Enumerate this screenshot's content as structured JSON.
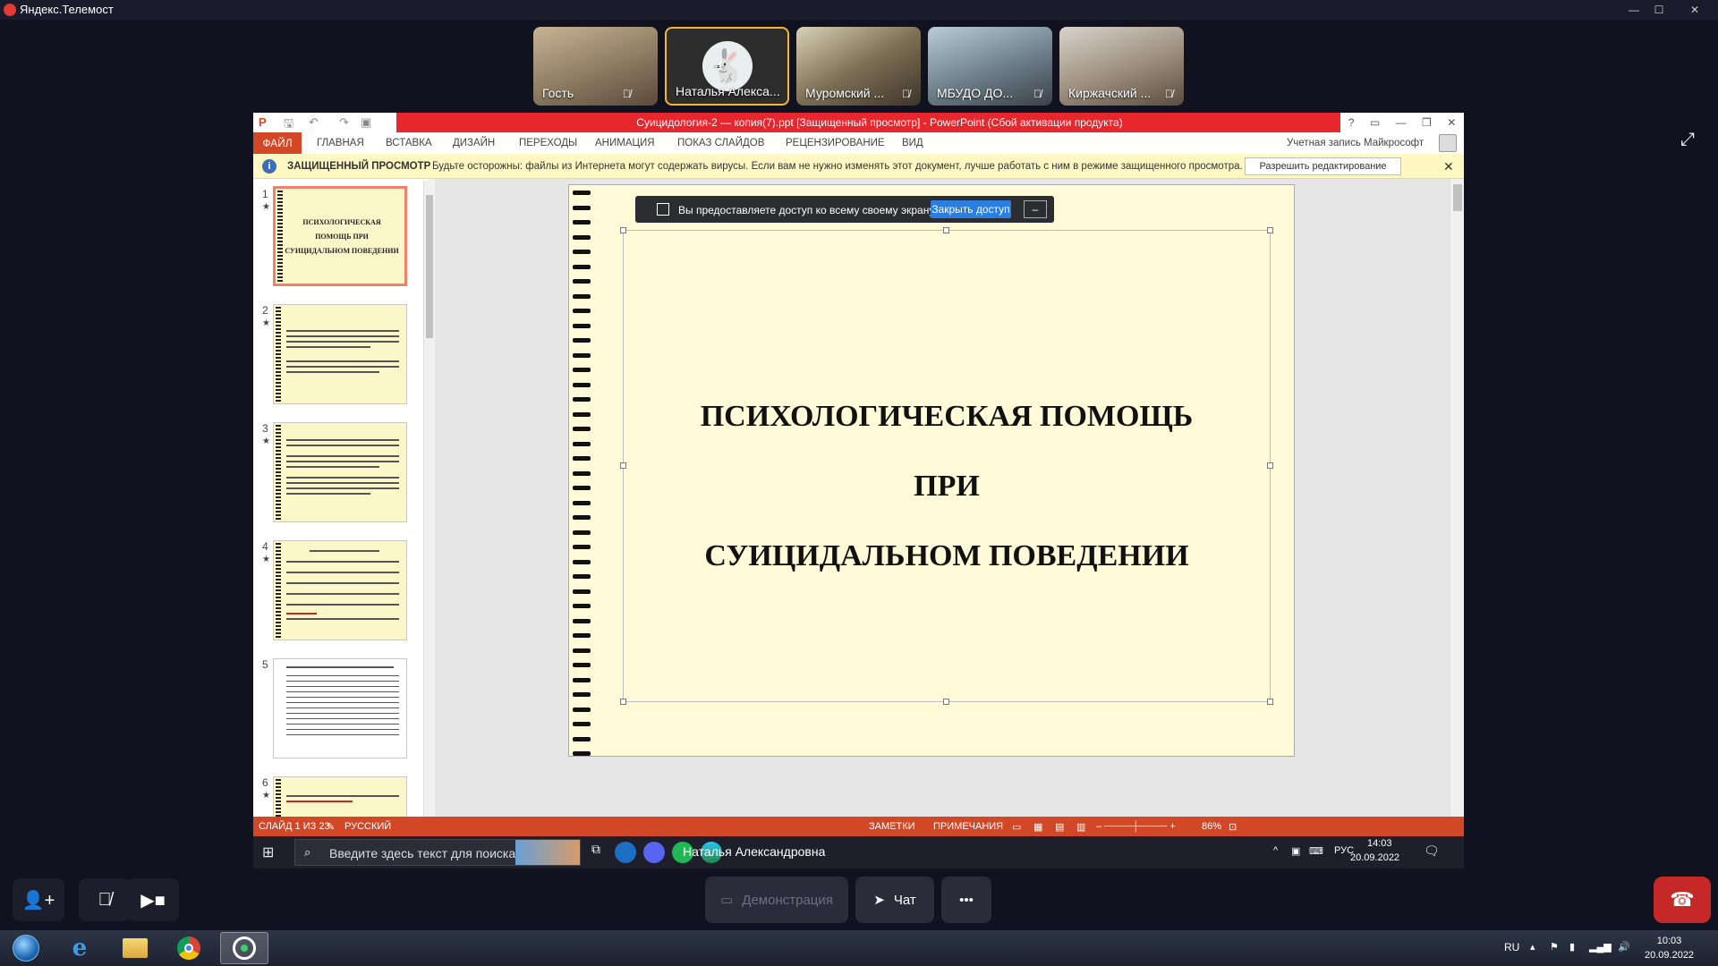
{
  "window": {
    "title": "Яндекс.Телемост"
  },
  "participants": [
    {
      "name": "Гость",
      "muted": true
    },
    {
      "name": "Наталья Алекса...",
      "muted": false,
      "active": true
    },
    {
      "name": "Муромский ...",
      "muted": true
    },
    {
      "name": "МБУДО ДО...",
      "muted": true
    },
    {
      "name": "Киржачский ...",
      "muted": true
    }
  ],
  "ppt": {
    "doc_title": "Суицидология-2 — копия(7).ppt [Защищенный просмотр] - PowerPoint (Сбой активации продукта)",
    "ribbon_tabs": [
      "ФАЙЛ",
      "ГЛАВНАЯ",
      "ВСТАВКА",
      "ДИЗАЙН",
      "ПЕРЕХОДЫ",
      "АНИМАЦИЯ",
      "ПОКАЗ СЛАЙДОВ",
      "РЕЦЕНЗИРОВАНИЕ",
      "ВИД"
    ],
    "account": "Учетная запись Майкрософт",
    "protected": {
      "title": "ЗАЩИЩЕННЫЙ ПРОСМОТР",
      "message": "Будьте осторожны: файлы из Интернета могут содержать вирусы. Если вам не нужно изменять этот документ, лучше работать с ним в режиме защищенного просмотра.",
      "enable_button": "Разрешить редактирование"
    },
    "thumbnails": [
      {
        "num": "1",
        "text": "ПСИХОЛОГИЧЕСКАЯ ПОМОЩЬ ПРИ СУИЦИДАЛЬНОМ ПОВЕДЕНИИ"
      },
      {
        "num": "2",
        "text": ""
      },
      {
        "num": "3",
        "text": ""
      },
      {
        "num": "4",
        "text": ""
      },
      {
        "num": "5",
        "text": ""
      },
      {
        "num": "6",
        "text": ""
      }
    ],
    "slide": {
      "line1": "ПСИХОЛОГИЧЕСКАЯ ПОМОЩЬ",
      "line2": "ПРИ",
      "line3": "СУИЦИДАЛЬНОМ ПОВЕДЕНИИ"
    },
    "share_bar": {
      "text": "Вы предоставляете доступ ко всему своему экрану.",
      "stop": "Закрыть доступ",
      "minimize": "–"
    },
    "status": {
      "slide": "СЛАЙД 1 ИЗ 23",
      "lang": "РУССКИЙ",
      "notes": "ЗАМЕТКИ",
      "comments": "ПРИМЕЧАНИЯ",
      "zoom": "86%"
    },
    "inner_taskbar": {
      "search_placeholder": "Введите здесь текст для поиска",
      "presenter": "Наталья Александровна",
      "lang": "РУС",
      "time": "14:03",
      "date": "20.09.2022"
    }
  },
  "controls": {
    "demo": "Демонстрация",
    "chat": "Чат",
    "more": "•••"
  },
  "taskbar": {
    "lang": "RU",
    "time": "10:03",
    "date": "20.09.2022"
  },
  "colors": {
    "ppt_accent": "#d24726",
    "slide_bg": "#fffbd8",
    "end_call": "#c62828"
  }
}
